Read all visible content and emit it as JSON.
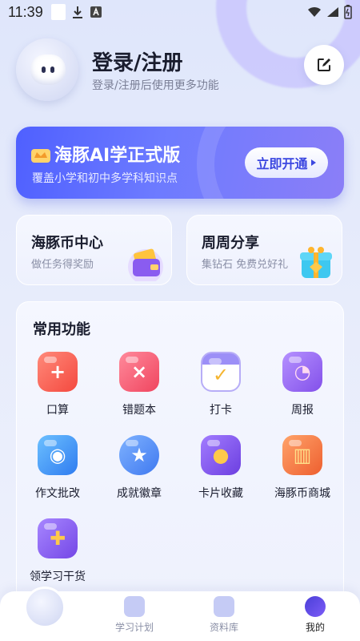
{
  "status_bar": {
    "time": "11:39"
  },
  "profile": {
    "title": "登录/注册",
    "subtitle": "登录/注册后使用更多功能"
  },
  "vip_banner": {
    "title": "海豚AI学正式版",
    "subtitle": "覆盖小学和初中多学科知识点",
    "button_label": "立即开通"
  },
  "cards": [
    {
      "title": "海豚币中心",
      "subtitle": "做任务得奖励",
      "icon": "wallet-icon"
    },
    {
      "title": "周周分享",
      "subtitle": "集钻石 免费兑好礼",
      "icon": "gift-box-icon"
    }
  ],
  "functions": {
    "title": "常用功能",
    "items": [
      {
        "label": "口算",
        "icon": "plus-icon",
        "color": "#f85a4e"
      },
      {
        "label": "错题本",
        "icon": "cross-icon",
        "color": "#f5506a"
      },
      {
        "label": "打卡",
        "icon": "calendar-check-icon",
        "color": "#8d80f0"
      },
      {
        "label": "周报",
        "icon": "report-icon",
        "color": "#9a62ef"
      },
      {
        "label": "作文批改",
        "icon": "camera-icon",
        "color": "#3d8ff3"
      },
      {
        "label": "成就徽章",
        "icon": "badge-icon",
        "color": "#4f87f1"
      },
      {
        "label": "卡片收藏",
        "icon": "card-icon",
        "color": "#8354ea"
      },
      {
        "label": "海豚币商城",
        "icon": "store-icon",
        "color": "#f37a3f"
      },
      {
        "label": "领学习干货",
        "icon": "gift-icon",
        "color": "#8a5ef0"
      }
    ]
  },
  "tabbar": {
    "tabs": [
      {
        "label": "学习计划"
      },
      {
        "label": "资料库"
      },
      {
        "label": "我的"
      }
    ]
  }
}
